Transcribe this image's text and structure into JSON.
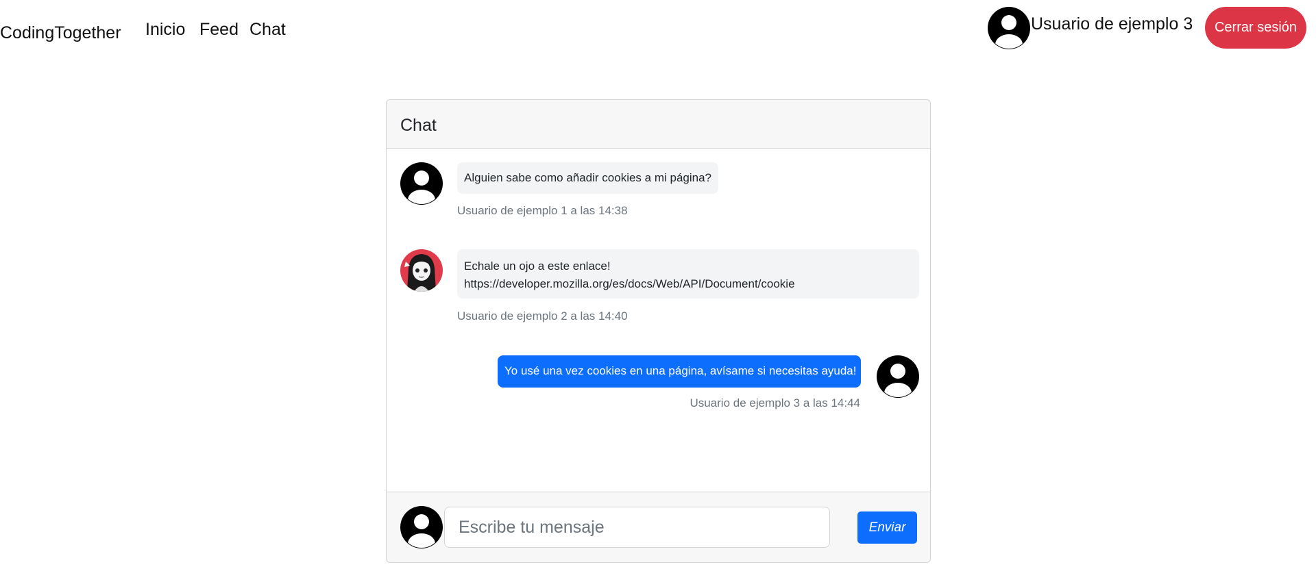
{
  "navbar": {
    "brand": "CodingTogether",
    "links": [
      "Inicio",
      "Feed",
      "Chat"
    ],
    "user_name": "Usuario de ejemplo 3",
    "avatar_icon": "default-user-avatar-icon",
    "logout_label": "Cerrar sesión"
  },
  "chat": {
    "title": "Chat",
    "messages": [
      {
        "text": "Alguien sabe como añadir cookies a mi página?",
        "meta": "Usuario de ejemplo 1 a las 14:38",
        "avatar": "default-user-avatar-icon",
        "own": false
      },
      {
        "text": "Echale un ojo a este enlace! https://developer.mozilla.org/es/docs/Web/API/Document/cookie",
        "meta": "Usuario de ejemplo 2 a las 14:40",
        "avatar": "anime-girl-avatar",
        "own": false
      },
      {
        "text": "Yo usé una vez cookies en una página, avísame si necesitas ayuda!",
        "meta": "Usuario de ejemplo 3 a las 14:44",
        "avatar": "default-user-avatar-icon",
        "own": true
      }
    ],
    "input": {
      "placeholder": "Escribe tu mensaje",
      "value": ""
    },
    "send_label": "Enviar"
  },
  "colors": {
    "primary": "#0d6efd",
    "danger": "#dc3545",
    "muted": "#6c757d",
    "bubble_bg": "#f3f4f6",
    "header_bg": "#f7f7f7"
  }
}
